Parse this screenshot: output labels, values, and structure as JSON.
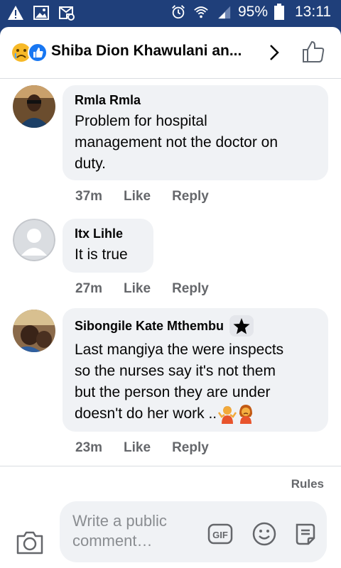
{
  "status_bar": {
    "battery": "95%",
    "time": "13:11",
    "icons": [
      "warning-icon",
      "image-icon",
      "email-icon",
      "alarm-icon",
      "wifi-icon",
      "signal-icon",
      "battery-icon"
    ]
  },
  "header": {
    "title": "Shiba Dion Khawulani an...",
    "reaction_icons": [
      "sad-reaction-icon",
      "like-reaction-icon"
    ],
    "chevron_icon": "chevron-right-icon",
    "like_icon": "thumbs-up-icon"
  },
  "comments": [
    {
      "author": "Rmla Rmla",
      "lines": [
        "Problem for hospital",
        "management not the doctor on",
        "duty."
      ],
      "time": "37m",
      "like": "Like",
      "reply": "Reply"
    },
    {
      "author": "Itx Lihle",
      "lines": [
        "It is true"
      ],
      "time": "27m",
      "like": "Like",
      "reply": "Reply"
    },
    {
      "author": "Sibongile Kate Mthembu",
      "badge_icon": "star-icon",
      "lines": [
        "Last mangiya the were inspects",
        "so the nurses say it's not them",
        "but the person they are under",
        "doesn't do her work .."
      ],
      "emoji": [
        "person-shrugging-icon",
        "person-pouting-icon"
      ],
      "time": "23m",
      "like": "Like",
      "reply": "Reply"
    }
  ],
  "footer": {
    "rules": "Rules",
    "placeholder_line1": "Write a public",
    "placeholder_line2": "comment…",
    "gif_label": "GIF",
    "icons": [
      "camera-icon",
      "gif-icon",
      "emoji-icon",
      "sticker-icon"
    ]
  },
  "colors": {
    "status_bar": "#1f3f7a",
    "bubble": "#f0f2f5",
    "meta_text": "#65676b",
    "text": "#050505"
  }
}
